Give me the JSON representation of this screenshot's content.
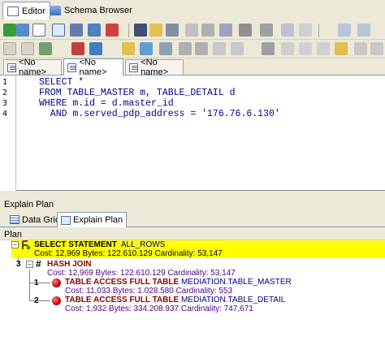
{
  "top_tabs": [
    {
      "label": "Editor",
      "active": true
    },
    {
      "label": "Schema Browser",
      "active": false
    }
  ],
  "doc_tabs": [
    {
      "label": "<No name>",
      "active": false
    },
    {
      "label": "<No name>",
      "active": true
    },
    {
      "label": "<No name>",
      "active": false
    }
  ],
  "editor": {
    "line_numbers": [
      "1",
      "2",
      "3",
      "4"
    ],
    "lines": [
      "SELECT *",
      "FROM TABLE_MASTER m, TABLE_DETAIL d",
      "WHERE m.id = d.master_id",
      "  AND m.served_pdp_address = '176.76.6.130'"
    ]
  },
  "explain_plan": {
    "header": "Explain Plan",
    "tabs": [
      {
        "label": "Data Grid",
        "active": false
      },
      {
        "label": "Explain Plan",
        "active": true
      }
    ],
    "plan_label": "Plan",
    "nodes": [
      {
        "id": "",
        "operation": "SELECT STATEMENT",
        "detail": "ALL_ROWS",
        "stats": "Cost: 12,969  Bytes: 122.610.129  Cardinality: 53,147",
        "highlight": true
      },
      {
        "id": "3",
        "operation": "HASH JOIN",
        "detail": "",
        "stats": "Cost: 12,969  Bytes: 122.610.129  Cardinality: 53,147",
        "highlight": false
      },
      {
        "id": "1",
        "operation": "TABLE ACCESS FULL TABLE",
        "detail": "MEDIATION.TABLE_MASTER",
        "stats": "Cost: 11,033  Bytes: 1.028.580  Cardinality: 553",
        "highlight": false
      },
      {
        "id": "2",
        "operation": "TABLE ACCESS FULL TABLE",
        "detail": "MEDIATION.TABLE_DETAIL",
        "stats": "Cost: 1,932  Bytes: 334.208.937  Cardinality: 747,671",
        "highlight": false
      }
    ]
  }
}
